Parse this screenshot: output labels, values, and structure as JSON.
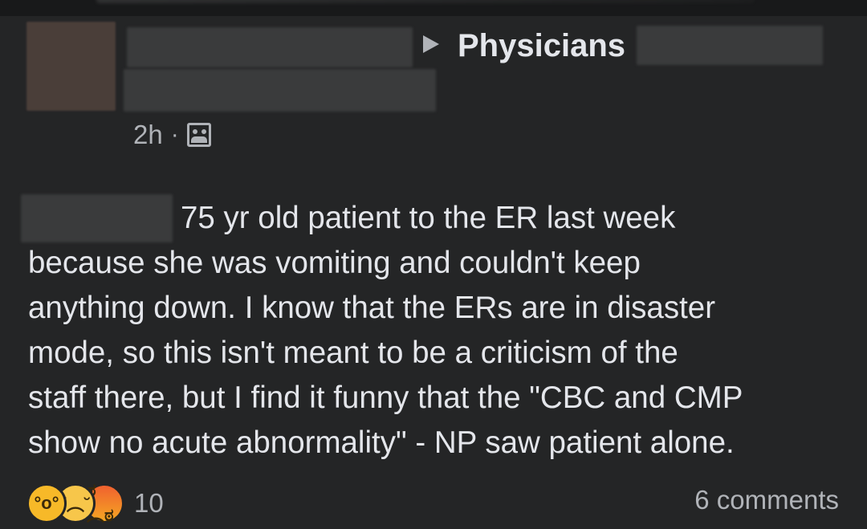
{
  "post": {
    "group_name": "Physicians",
    "timestamp": "2h",
    "separator": "·",
    "privacy_icon": "group-members-icon",
    "body_lines": [
      "75 yr old patient to the ER last week",
      "because she was vomiting and couldn't keep",
      "anything down. I know that the ERs are in disaster",
      "mode, so this isn't meant to be a criticism of the",
      "staff there, but I find it funny that the \"CBC and CMP",
      "show no acute abnormality\" -  NP saw patient alone."
    ]
  },
  "footer": {
    "reaction_icons": [
      "wow-reaction-icon",
      "sad-reaction-icon",
      "angry-reaction-icon"
    ],
    "reaction_count": "10",
    "comments_label": "6 comments"
  },
  "colors": {
    "background": "#242526",
    "text_primary": "#e4e6eb",
    "text_secondary": "#b0b3b8"
  }
}
